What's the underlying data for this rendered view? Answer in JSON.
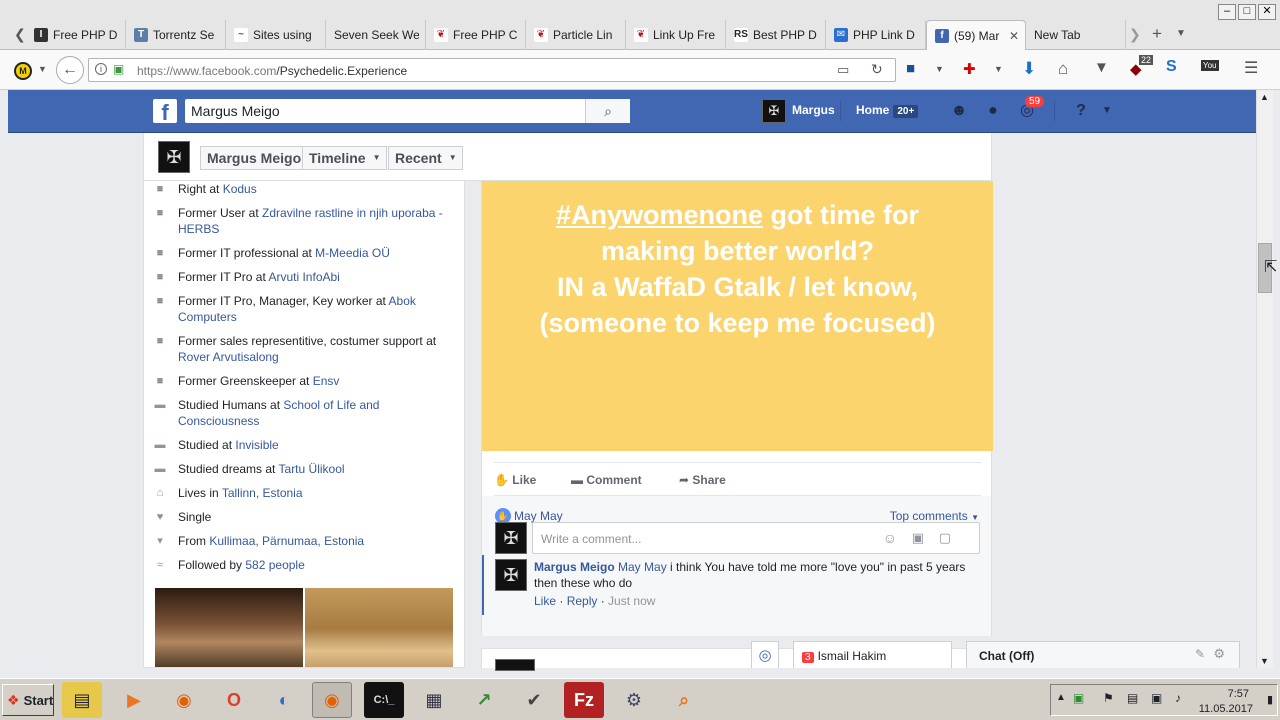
{
  "browser": {
    "tabs": [
      {
        "label": "Free PHP D",
        "icon": "letter-i-icon",
        "active": false
      },
      {
        "label": "Torrentz Se",
        "icon": "torrentz-icon",
        "active": false
      },
      {
        "label": "Sites using",
        "icon": "wave-icon",
        "active": false
      },
      {
        "label": "Seven Seek Wel",
        "icon": "",
        "active": false
      },
      {
        "label": "Free PHP C",
        "icon": "red-shape-icon",
        "active": false
      },
      {
        "label": "Particle Lin",
        "icon": "red-shape-icon",
        "active": false
      },
      {
        "label": "Link Up Fre",
        "icon": "red-shape-icon",
        "active": false
      },
      {
        "label": "Best PHP D",
        "icon": "rs-icon",
        "active": false
      },
      {
        "label": "PHP Link D",
        "icon": "blue-icon",
        "active": false
      },
      {
        "label": "(59) Mar",
        "icon": "facebook-icon",
        "active": true
      },
      {
        "label": "New Tab",
        "icon": "",
        "active": false
      }
    ],
    "url_host": "https://www.facebook.com",
    "url_path": "/Psychedelic.Experience",
    "ext_badge": "22"
  },
  "fb": {
    "search_value": "Margus Meigo",
    "profile_name": "Margus",
    "home_label": "Home",
    "home_badge": "20+",
    "notif_badge": "59"
  },
  "timeline_nav": {
    "name": "Margus Meigo",
    "timeline": "Timeline",
    "recent": "Recent"
  },
  "intro": [
    {
      "icon": "briefcase-icon",
      "text": "Right at ",
      "link": "Kodus"
    },
    {
      "icon": "briefcase-icon",
      "text": "Former User at ",
      "link": "Zdravilne rastline in njih uporaba - HERBS"
    },
    {
      "icon": "briefcase-icon",
      "text": "Former IT professional at ",
      "link": "M-Meedia OÜ"
    },
    {
      "icon": "briefcase-icon",
      "text": "Former IT Pro at ",
      "link": "Arvuti InfoAbi"
    },
    {
      "icon": "briefcase-icon",
      "text": "Former IT Pro, Manager, Key worker at ",
      "link": "Abok Computers"
    },
    {
      "icon": "briefcase-icon",
      "text": "Former sales representitive, costumer support at ",
      "link": "Rover Arvutisalong"
    },
    {
      "icon": "briefcase-icon",
      "text": "Former Greenskeeper at ",
      "link": "Ensv"
    },
    {
      "icon": "graduation-cap-icon",
      "text": "Studied Humans at ",
      "link": "School of Life and Consciousness"
    },
    {
      "icon": "graduation-cap-icon",
      "text": "Studied at ",
      "link": "Invisible"
    },
    {
      "icon": "graduation-cap-icon",
      "text": "Studied dreams at ",
      "link": "Tartu Ülikool"
    },
    {
      "icon": "home-icon",
      "text": "Lives in ",
      "link": "Tallinn, Estonia"
    },
    {
      "icon": "heart-icon",
      "text": "Single",
      "link": ""
    },
    {
      "icon": "location-pin-icon",
      "text": "From ",
      "link": "Kullimaa, Pärnumaa, Estonia"
    },
    {
      "icon": "rss-icon",
      "text": "Followed by ",
      "link": "582 people"
    }
  ],
  "post": {
    "hashtag": "#Anywomenone",
    "line1_rest": " got time for",
    "line2": "making better world?",
    "line3": "IN a WaffaD Gtalk / let know,",
    "line4": "(someone to keep me focused)",
    "bg_color": "#fbd46d",
    "like": "Like",
    "comment": "Comment",
    "share": "Share",
    "likes_by": "May May",
    "top_comments": "Top comments",
    "comment_placeholder": "Write a comment...",
    "comment_author": "Margus Meigo",
    "comment_mention": "May May",
    "comment_text": " i think You have told me more \"love you\" in past 5 years then these who do",
    "comment_like": "Like",
    "comment_reply": "Reply",
    "comment_time": "Just now"
  },
  "chat": {
    "conversation_count": "3",
    "conversation_name": "Ismail Hakim",
    "status": "Chat (Off)"
  },
  "taskbar": {
    "start": "Start",
    "time": "7:57",
    "date": "11.05.2017"
  }
}
